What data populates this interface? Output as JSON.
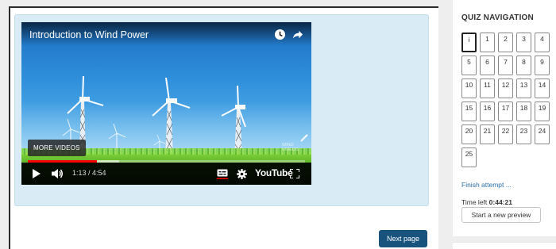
{
  "video": {
    "title": "Introduction to Wind Power",
    "more_videos_label": "MORE VIDEOS",
    "watermark": "WIND\nVIDEOS",
    "time_display": "1:13 / 4:54",
    "brand": "YouTube",
    "progress_played": 0.248,
    "progress_buffered": 0.33,
    "icons": [
      "clock-icon",
      "share-icon",
      "play-icon",
      "volume-icon",
      "captions-icon",
      "settings-icon",
      "fullscreen-icon"
    ]
  },
  "footer": {
    "next_page_label": "Next page"
  },
  "quiz_nav": {
    "title": "QUIZ NAVIGATION",
    "current_question": "i",
    "questions": [
      "i",
      "1",
      "2",
      "3",
      "4",
      "5",
      "6",
      "7",
      "8",
      "9",
      "10",
      "11",
      "12",
      "13",
      "14",
      "15",
      "16",
      "17",
      "18",
      "19",
      "20",
      "21",
      "22",
      "23",
      "24",
      "25"
    ],
    "finish_attempt_label": "Finish attempt ...",
    "time_left_label": "Time left",
    "time_left_value": "0:44:21",
    "new_preview_label": "Start a new preview"
  },
  "colors": {
    "content_box": "#d9ebf5",
    "primary_button": "#18537e",
    "link": "#2a6ea8",
    "progress": "#ff0000"
  }
}
